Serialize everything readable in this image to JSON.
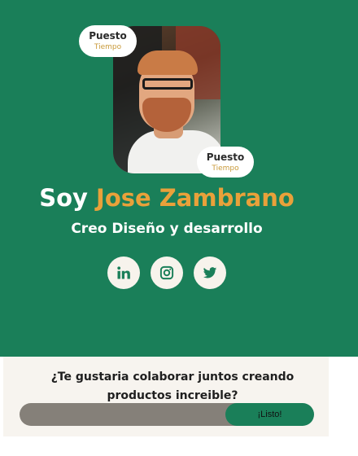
{
  "colors": {
    "primary_green": "#1a7f59",
    "accent_orange": "#e9a13a",
    "light_background": "#f7f4ef",
    "input_gray": "#858079",
    "badge_subtitle": "#c99a3a"
  },
  "hero": {
    "photo_alt": "Jose Zambrano",
    "badges": [
      {
        "title": "Puesto",
        "subtitle": "Tiempo"
      },
      {
        "title": "Puesto",
        "subtitle": "Tiempo"
      }
    ],
    "title_prefix": "Soy",
    "name": "Jose Zambrano",
    "subtitle": "Creo Diseño y desarrollo"
  },
  "socials": [
    {
      "icon": "linkedin-icon"
    },
    {
      "icon": "instagram-icon"
    },
    {
      "icon": "twitter-icon"
    }
  ],
  "collab": {
    "question": "¿Te gustaria colaborar juntos creando productos increible?",
    "email_value": "",
    "email_placeholder": "",
    "submit_label": "¡Listo!"
  }
}
